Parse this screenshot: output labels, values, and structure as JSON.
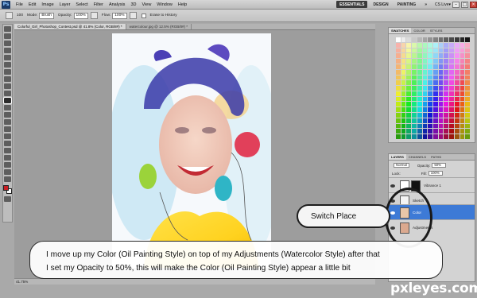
{
  "app": {
    "logo": "Ps"
  },
  "menu": {
    "items": [
      "File",
      "Edit",
      "Image",
      "Layer",
      "Select",
      "Filter",
      "Analysis",
      "3D",
      "View",
      "Window",
      "Help"
    ],
    "workspaces": [
      "ESSENTIALS",
      "DESIGN",
      "PAINTING",
      "»"
    ],
    "cslive": "CS Live▾",
    "window_controls": [
      "–",
      "□",
      "×"
    ]
  },
  "options": {
    "brush_size": "100",
    "mode_label": "Mode:",
    "mode_value": "Brush",
    "opacity_label": "Opacity:",
    "opacity_value": "100%",
    "flow_label": "Flow:",
    "flow_value": "100%",
    "erase_history": "Erase to History"
  },
  "documents": {
    "tabs": [
      "Colorful_Girl_Photoshop_Contest.psd @ 41.8% (Color, RGB/8#) *",
      "watercolour.jpg @ 12.5% (RGB/8#) *"
    ]
  },
  "status": {
    "zoom": "41.75%"
  },
  "swatches_panel": {
    "tabs": [
      "SWATCHES",
      "COLOR",
      "STYLES"
    ]
  },
  "layers_panel": {
    "tabs": [
      "LAYERS",
      "CHANNELS",
      "PATHS"
    ],
    "blend_mode": "Normal",
    "opacity_label": "Opacity:",
    "opacity_value": "50%",
    "lock_label": "Lock:",
    "fill_label": "Fill:",
    "fill_value": "100%",
    "layers": [
      {
        "name": "Vibrance 1",
        "selected": false
      },
      {
        "name": "Sketch",
        "selected": false
      },
      {
        "name": "Color",
        "selected": true
      },
      {
        "name": "Adjustments",
        "selected": false
      }
    ]
  },
  "annotations": {
    "callout": "Switch Place",
    "caption_lines": [
      "I move up my Color (Oil Painting Style) on top of my Adjustments (Watercolor Style) after that",
      "I set my Opacity to 50%, this will make the Color (Oil Painting Style) appear a little bit"
    ],
    "watermark": "pxleyes.com"
  },
  "colors": {
    "selected_layer": "#3d7ad6",
    "foreground": "#c81e23",
    "background": "#ffffff"
  }
}
